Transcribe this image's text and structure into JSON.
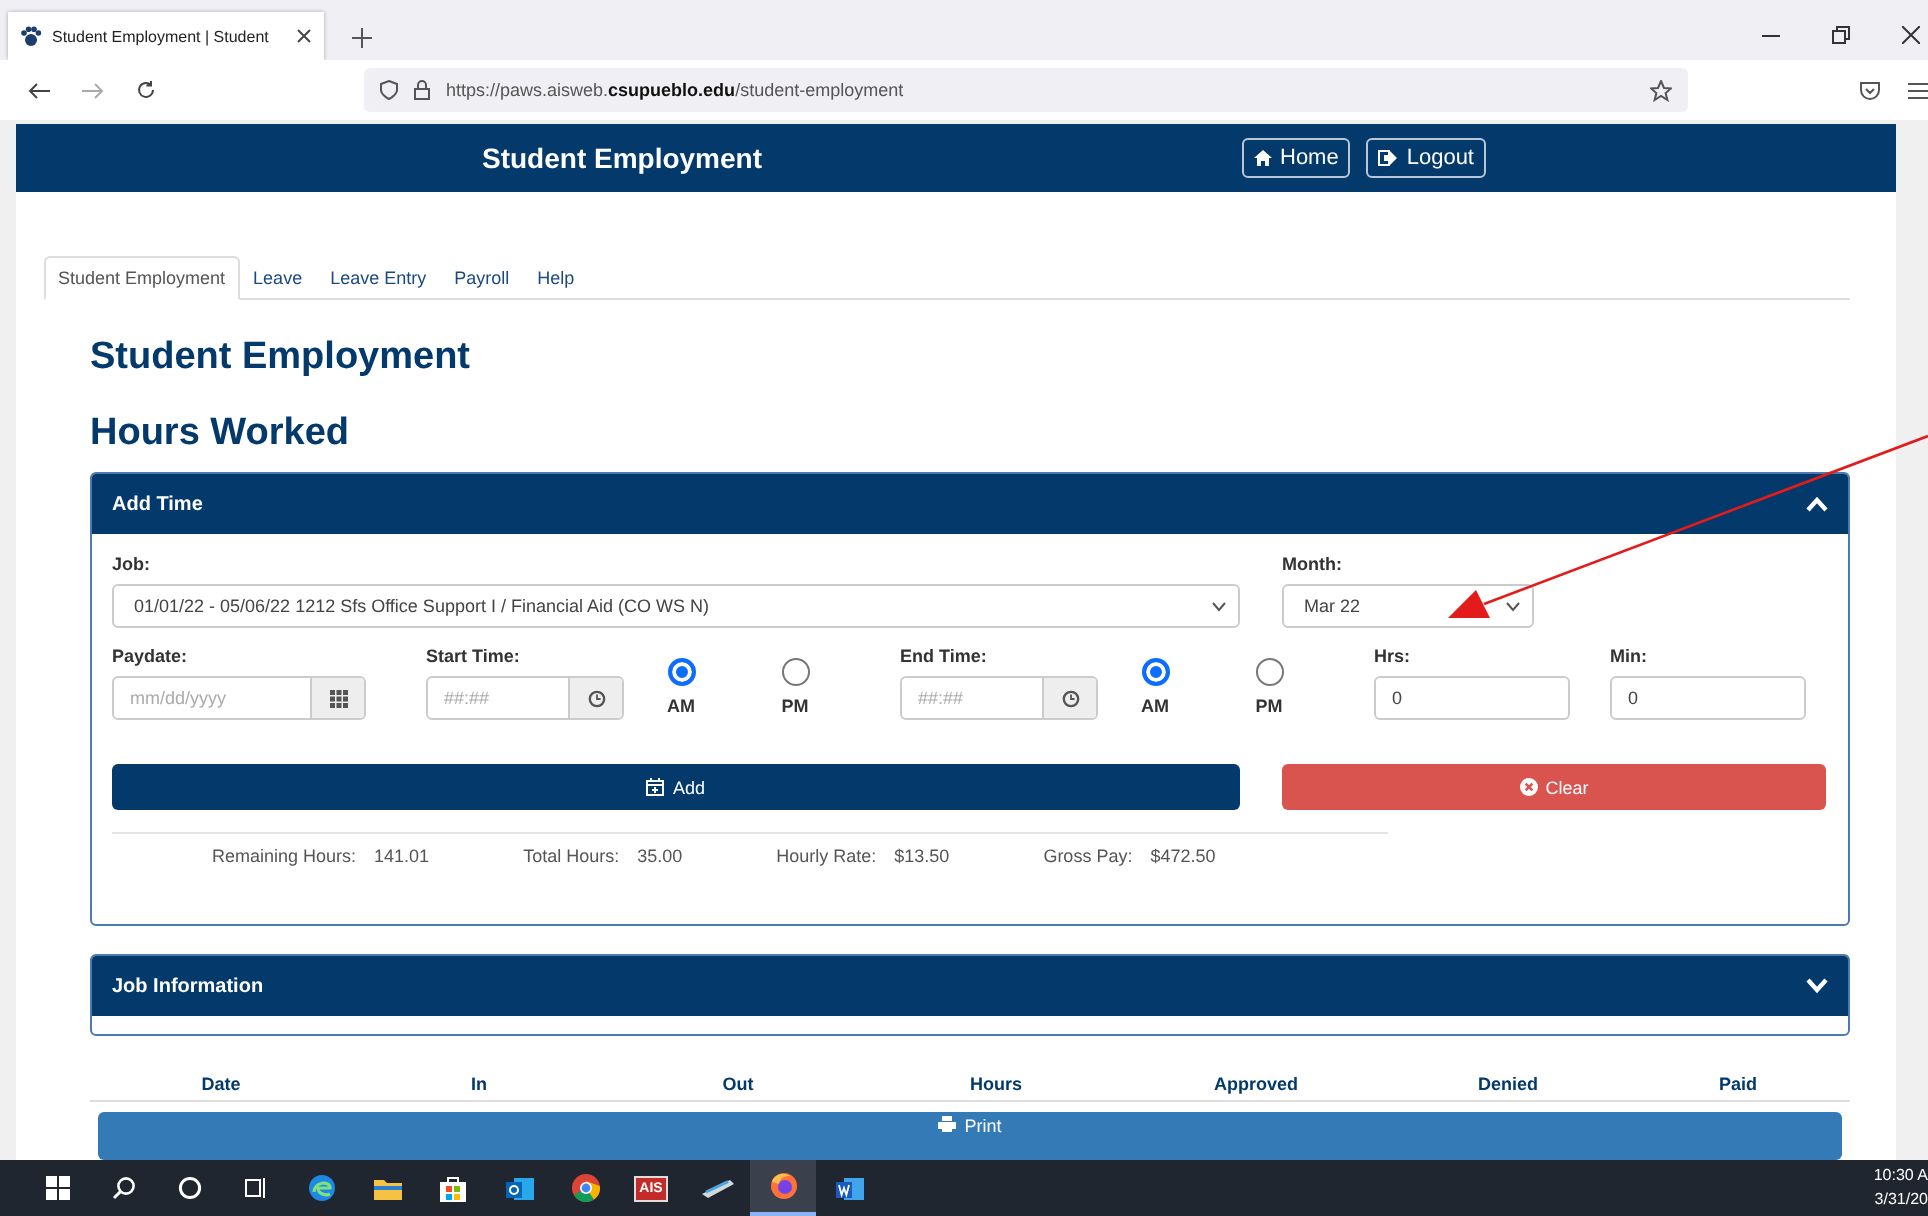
{
  "browser": {
    "tab_title": "Student Employment | Student",
    "url": "https://paws.aisweb.**csupueblo.edu**/student-employment"
  },
  "header": {
    "title": "Student Employment",
    "buttons": [
      {
        "label": "Home",
        "kind": "home"
      },
      {
        "label": "Logout",
        "kind": "logout"
      }
    ]
  },
  "tabs": [
    {
      "label": "Student Employment",
      "selected": true
    },
    {
      "label": "Leave",
      "selected": false
    },
    {
      "label": "Leave Entry",
      "selected": false
    },
    {
      "label": "Payroll",
      "selected": false
    },
    {
      "label": "Help",
      "selected": false
    }
  ],
  "page_title": "Student Employment",
  "section_title": "Hours Worked",
  "add_time": {
    "title": "Add Time",
    "expanded": true,
    "job": {
      "label": "Job:",
      "value": "01/01/22 - 05/06/22  1212  Sfs Office Support I / Financial Aid (CO WS N)"
    },
    "month": {
      "label": "Month:",
      "value": "Mar 22"
    },
    "paydate": {
      "label": "Paydate:",
      "placeholder": "mm/dd/yyyy"
    },
    "start_time": {
      "label": "Start Time:",
      "placeholder": "##:##",
      "options": [
        {
          "label": "AM",
          "selected": true
        },
        {
          "label": "PM",
          "selected": false
        }
      ]
    },
    "end_time": {
      "label": "End Time:",
      "placeholder": "##:##",
      "options": [
        {
          "label": "AM",
          "selected": true
        },
        {
          "label": "PM",
          "selected": false
        }
      ]
    },
    "hrs": {
      "label": "Hrs:",
      "value": "0"
    },
    "min": {
      "label": "Min:",
      "value": "0"
    },
    "add_button": "Add",
    "clear_button": "Clear",
    "summary": [
      {
        "label": "Remaining Hours:",
        "value": "141.01"
      },
      {
        "label": "Total Hours:",
        "value": "35.00"
      },
      {
        "label": "Hourly Rate:",
        "value": "$13.50"
      },
      {
        "label": "Gross Pay:",
        "value": "$472.50"
      }
    ]
  },
  "job_information": {
    "title": "Job Information",
    "expanded": false
  },
  "table": {
    "columns": [
      "Date",
      "In",
      "Out",
      "Hours",
      "Approved",
      "Denied",
      "Paid"
    ]
  },
  "print_button": "Print",
  "taskbar": {
    "app_label": "AIS",
    "time": "10:30 A",
    "date": "3/31/20"
  }
}
